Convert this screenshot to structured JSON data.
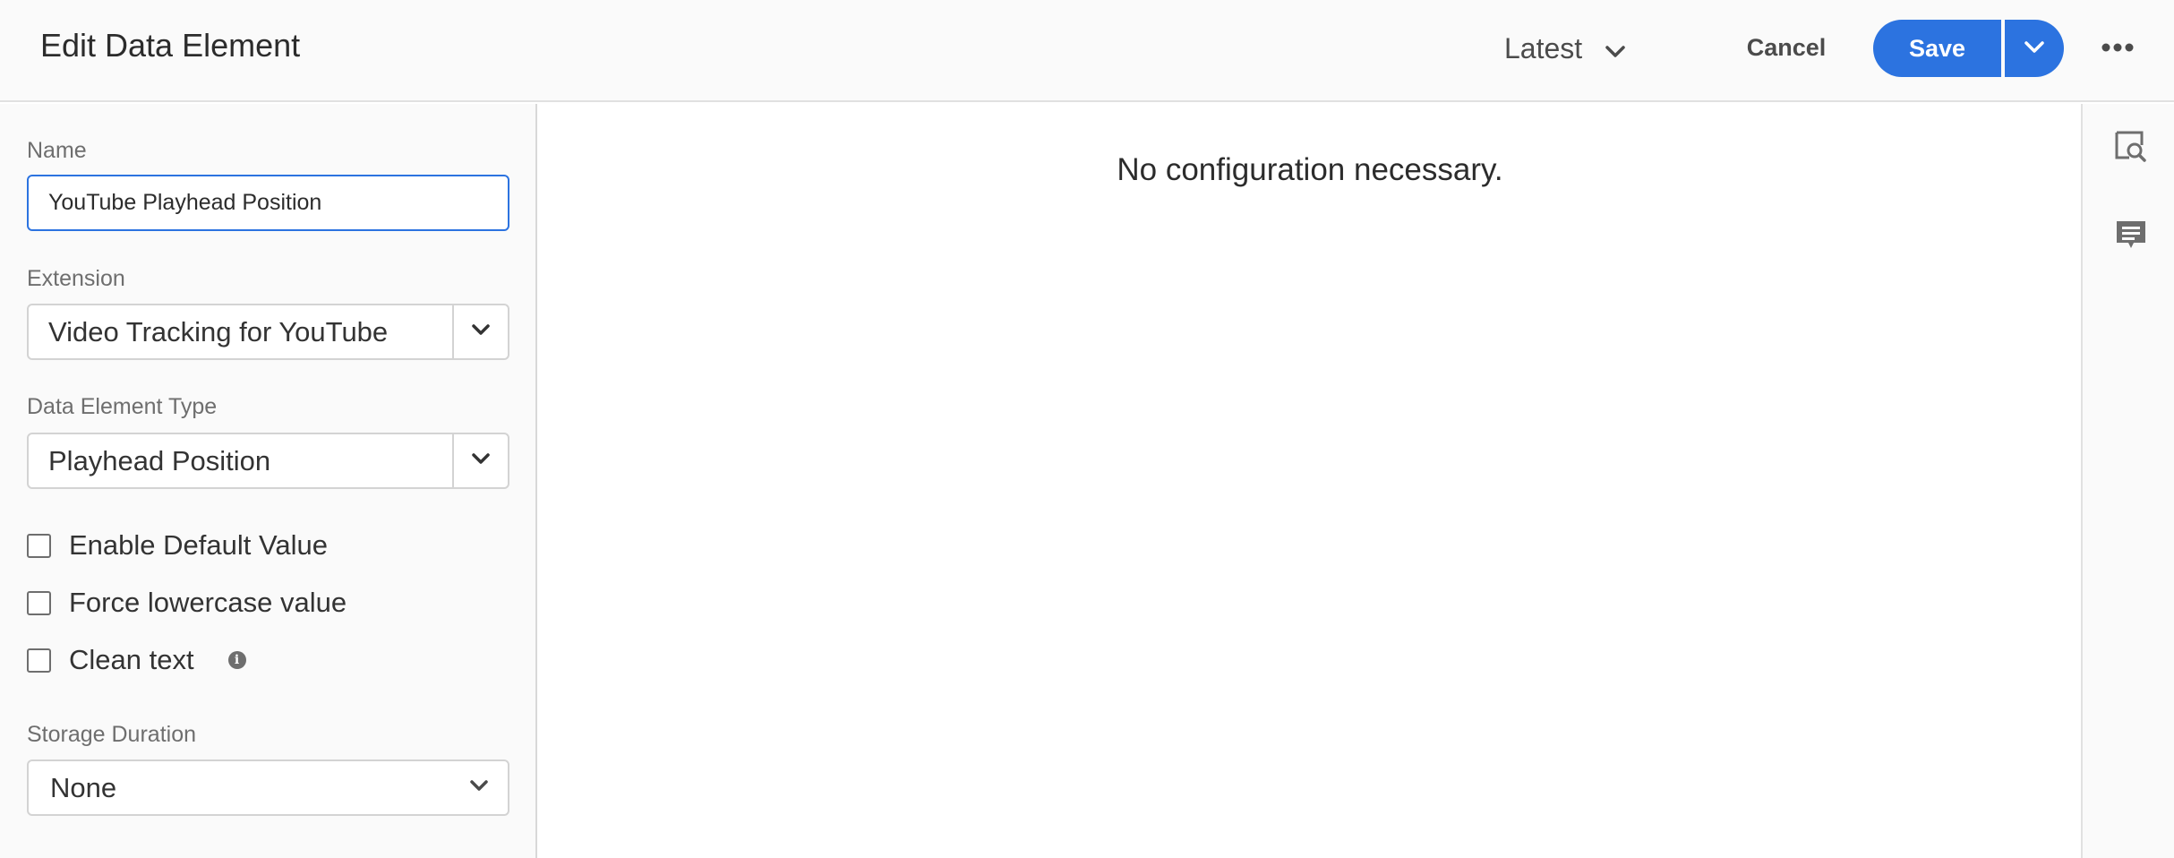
{
  "header": {
    "title": "Edit Data Element",
    "version_label": "Latest",
    "cancel_label": "Cancel",
    "save_label": "Save"
  },
  "form": {
    "name_label": "Name",
    "name_value": "YouTube Playhead Position",
    "extension_label": "Extension",
    "extension_value": "Video Tracking for YouTube",
    "type_label": "Data Element Type",
    "type_value": "Playhead Position",
    "checkboxes": [
      {
        "label": "Enable Default Value",
        "checked": false
      },
      {
        "label": "Force lowercase value",
        "checked": false
      },
      {
        "label": "Clean text",
        "checked": false
      }
    ],
    "storage_label": "Storage Duration",
    "storage_value": "None"
  },
  "main": {
    "message": "No configuration necessary."
  },
  "colors": {
    "accent": "#2c73e0",
    "panel_bg": "#fafafa",
    "border": "#d3d3d3"
  },
  "icons": {
    "version_chevron": "chevron-down-icon",
    "save_menu": "chevron-down-icon",
    "more": "ellipsis-icon",
    "clean_text_info": "info-icon",
    "rail_1": "preview-search-icon",
    "rail_2": "comment-icon"
  }
}
